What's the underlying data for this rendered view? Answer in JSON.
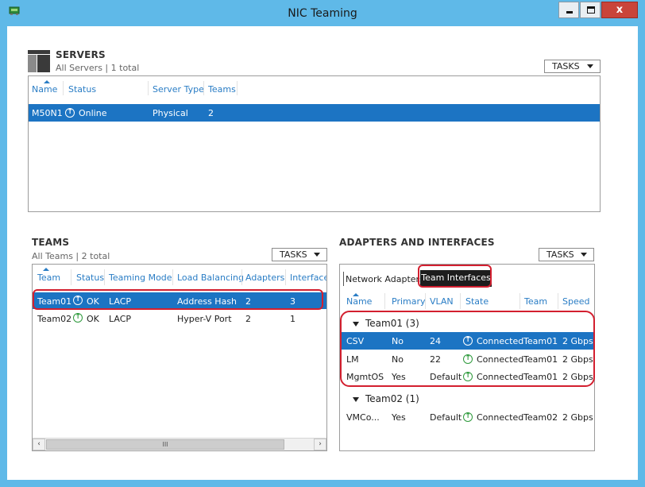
{
  "window": {
    "title": "NIC Teaming",
    "close_glyph": "x"
  },
  "servers": {
    "title": "SERVERS",
    "subtitle": "All Servers | 1 total",
    "tasks_label": "TASKS",
    "columns": [
      "Name",
      "Status",
      "Server Type",
      "Teams"
    ],
    "rows": [
      {
        "name": "M50N1",
        "status": "Online",
        "type": "Physical",
        "teams": "2"
      }
    ]
  },
  "teams": {
    "title": "TEAMS",
    "subtitle": "All Teams | 2 total",
    "tasks_label": "TASKS",
    "columns": [
      "Team",
      "Status",
      "Teaming Mode",
      "Load Balancing",
      "Adapters",
      "Interfaces"
    ],
    "rows": [
      {
        "team": "Team01",
        "status": "OK",
        "mode": "LACP",
        "lb": "Address Hash",
        "adapters": "2",
        "interfaces": "3"
      },
      {
        "team": "Team02",
        "status": "OK",
        "mode": "LACP",
        "lb": "Hyper-V Port",
        "adapters": "2",
        "interfaces": "1"
      }
    ],
    "scroll_thumb": "III"
  },
  "adapters": {
    "title": "ADAPTERS AND INTERFACES",
    "tasks_label": "TASKS",
    "tabs": [
      "Network Adapters",
      "Team Interfaces"
    ],
    "columns": [
      "Name",
      "Primary",
      "VLAN",
      "State",
      "Team",
      "Speed"
    ],
    "groups": [
      {
        "label": "Team01 (3)",
        "rows": [
          {
            "name": "CSV",
            "primary": "No",
            "vlan": "24",
            "state": "Connected",
            "team": "Team01",
            "speed": "2 Gbps"
          },
          {
            "name": "LM",
            "primary": "No",
            "vlan": "22",
            "state": "Connected",
            "team": "Team01",
            "speed": "2 Gbps"
          },
          {
            "name": "MgmtOS",
            "primary": "Yes",
            "vlan": "Default",
            "state": "Connected",
            "team": "Team01",
            "speed": "2 Gbps"
          }
        ]
      },
      {
        "label": "Team02 (1)",
        "rows": [
          {
            "name": "VMCo...",
            "primary": "Yes",
            "vlan": "Default",
            "state": "Connected",
            "team": "Team02",
            "speed": "2 Gbps"
          }
        ]
      }
    ]
  }
}
